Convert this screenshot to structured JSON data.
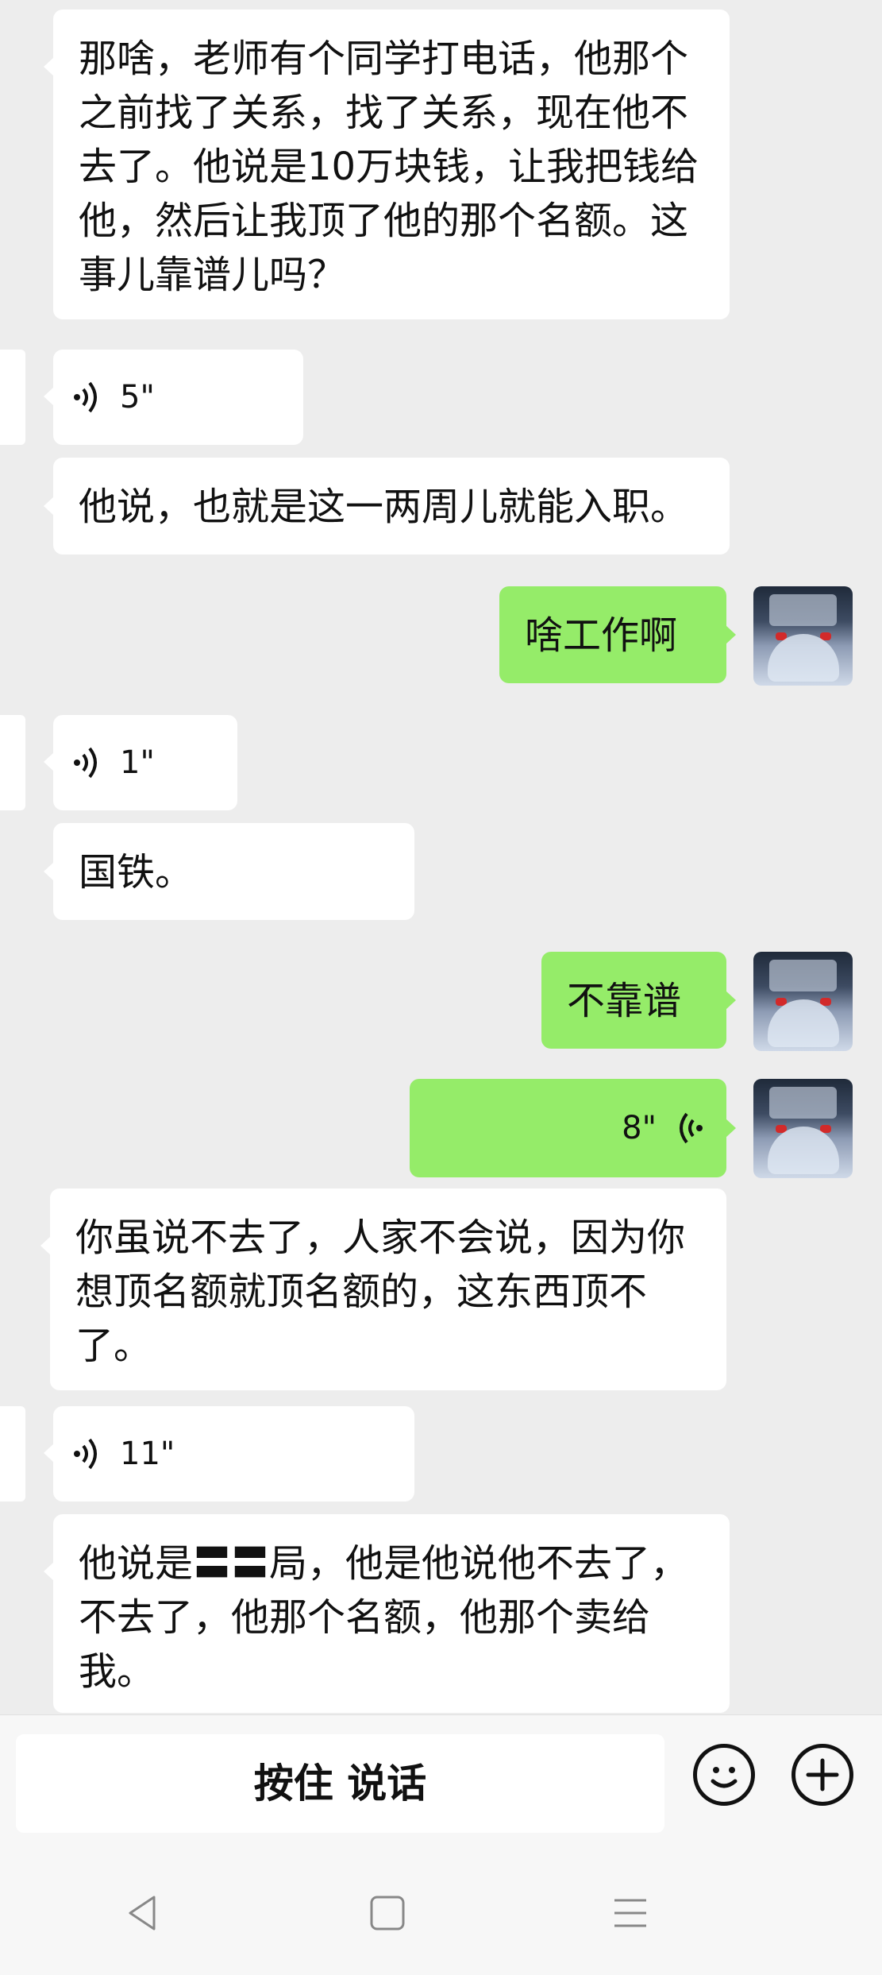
{
  "messages": [
    {
      "side": "in",
      "type": "text",
      "text": "那啥，老师有个同学打电话，他那个之前找了关系，找了关系，现在他不去了。他说是10万块钱，让我把钱给他，然后让我顶了他的那个名额。这事儿靠谱儿吗？"
    },
    {
      "side": "in",
      "type": "voice",
      "duration": "5\""
    },
    {
      "side": "in",
      "type": "text",
      "text": "他说，也就是这一两周儿就能入职。"
    },
    {
      "side": "out",
      "type": "text",
      "text": "啥工作啊"
    },
    {
      "side": "in",
      "type": "voice",
      "duration": "1\""
    },
    {
      "side": "in",
      "type": "text",
      "text": "国铁。"
    },
    {
      "side": "out",
      "type": "text",
      "text": "不靠谱"
    },
    {
      "side": "out",
      "type": "voice",
      "duration": "8\""
    },
    {
      "side": "in",
      "type": "text",
      "text": "你虽说不去了，人家不会说，因为你想顶名额就顶名额的，这东西顶不了。"
    },
    {
      "side": "in",
      "type": "voice",
      "duration": "11\""
    },
    {
      "side": "in",
      "type": "text",
      "text": "他说是〓〓局，他是他说他不去了，不去了，他那个名额，他那个卖给我。"
    }
  ],
  "input_bar": {
    "hold_to_talk_label": "按住 说话",
    "emoji_icon": "smiley-icon",
    "more_icon": "plus-circle-icon"
  },
  "nav_bar": {
    "back_icon": "back-triangle-icon",
    "home_icon": "home-square-icon",
    "menu_icon": "menu-lines-icon"
  },
  "colors": {
    "background": "#ededed",
    "incoming_bubble": "#ffffff",
    "outgoing_bubble": "#95ec69"
  }
}
